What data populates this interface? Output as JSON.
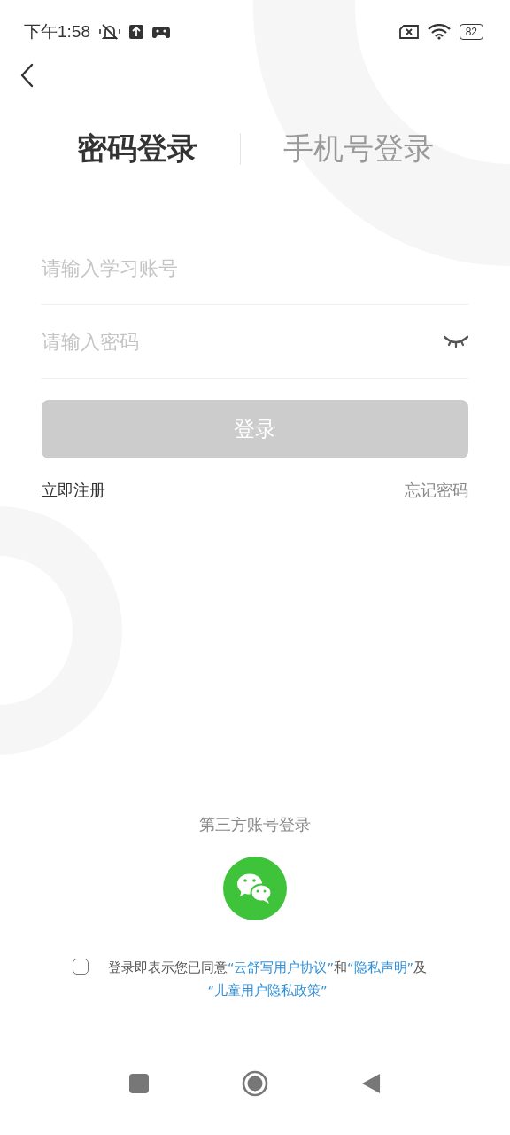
{
  "status_bar": {
    "time": "下午1:58",
    "battery": "82"
  },
  "tabs": [
    {
      "label": "密码登录",
      "selected": true
    },
    {
      "label": "手机号登录",
      "selected": false
    }
  ],
  "fields": [
    {
      "kind": "text",
      "placeholder": "请输入学习账号"
    },
    {
      "kind": "password",
      "placeholder": "请输入密码",
      "password_visible": false
    }
  ],
  "login_button": {
    "label": "登录",
    "disabled": true
  },
  "links": {
    "register": "立即注册",
    "forgot": "忘记密码"
  },
  "third_party": {
    "title": "第三方账号登录"
  },
  "agreement": {
    "checked": false,
    "parts": [
      {
        "kind": "text",
        "text": "登录即表示您已同意"
      },
      {
        "kind": "link",
        "text": "“云舒写用户协议”"
      },
      {
        "kind": "text",
        "text": "和"
      },
      {
        "kind": "link",
        "text": "“隐私声明”"
      },
      {
        "kind": "text",
        "text": "及"
      },
      {
        "kind": "link",
        "text": "“儿童用户隐私政策”"
      }
    ]
  }
}
